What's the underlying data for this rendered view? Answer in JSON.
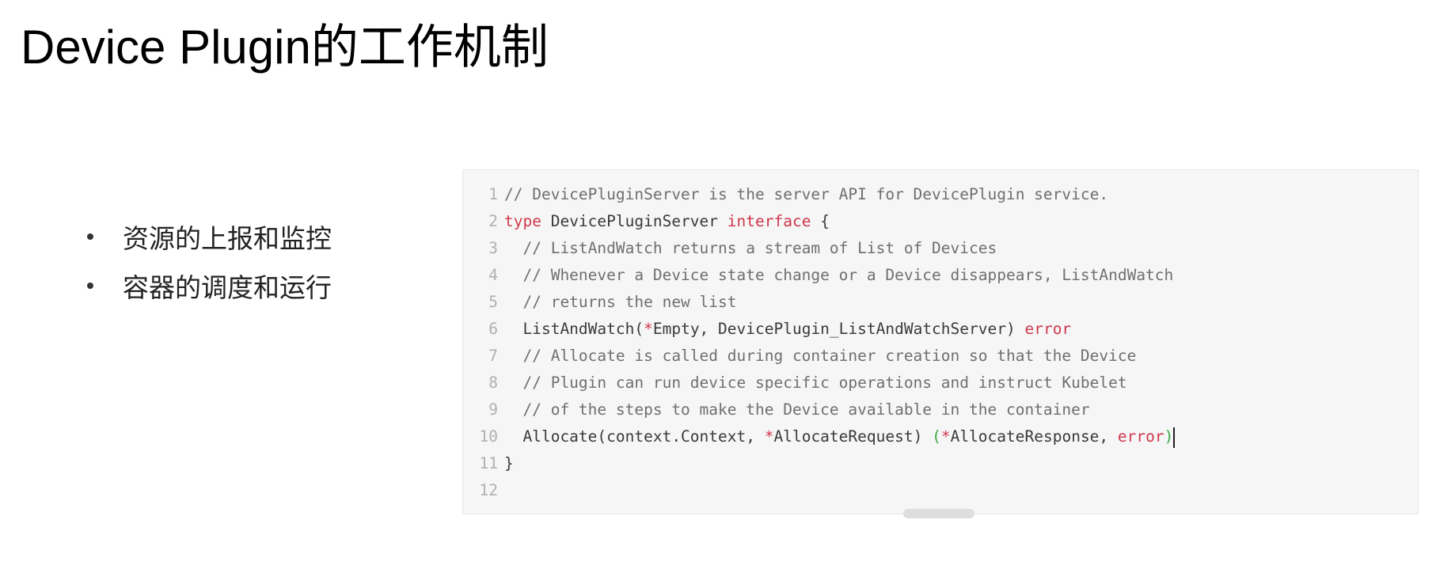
{
  "title": "Device Plugin的工作机制",
  "bullets": [
    "资源的上报和监控",
    "容器的调度和运行"
  ],
  "code": {
    "lines": [
      {
        "n": "1",
        "tokens": [
          {
            "t": "// DevicePluginServer is the server API for DevicePlugin service.",
            "c": "comment"
          }
        ]
      },
      {
        "n": "2",
        "tokens": [
          {
            "t": "type",
            "c": "kw"
          },
          {
            "t": " DevicePluginServer ",
            "c": "plain"
          },
          {
            "t": "interface",
            "c": "kw"
          },
          {
            "t": " {",
            "c": "plain"
          }
        ]
      },
      {
        "n": "3",
        "tokens": [
          {
            "t": "  // ListAndWatch returns a stream of List of Devices",
            "c": "comment"
          }
        ]
      },
      {
        "n": "4",
        "tokens": [
          {
            "t": "  // Whenever a Device state change or a Device disappears, ListAndWatch",
            "c": "comment"
          }
        ]
      },
      {
        "n": "5",
        "tokens": [
          {
            "t": "  // returns the new list",
            "c": "comment"
          }
        ]
      },
      {
        "n": "6",
        "tokens": [
          {
            "t": "  ListAndWatch(",
            "c": "plain"
          },
          {
            "t": "*",
            "c": "red"
          },
          {
            "t": "Empty, DevicePlugin_ListAndWatchServer) ",
            "c": "plain"
          },
          {
            "t": "error",
            "c": "red"
          }
        ]
      },
      {
        "n": "7",
        "tokens": [
          {
            "t": "  // Allocate is called during container creation so that the Device",
            "c": "comment"
          }
        ]
      },
      {
        "n": "8",
        "tokens": [
          {
            "t": "  // Plugin can run device specific operations and instruct Kubelet",
            "c": "comment"
          }
        ]
      },
      {
        "n": "9",
        "tokens": [
          {
            "t": "  // of the steps to make the Device available in the container",
            "c": "comment"
          }
        ]
      },
      {
        "n": "10",
        "tokens": [
          {
            "t": "  Allocate(context.Context, ",
            "c": "plain"
          },
          {
            "t": "*",
            "c": "red"
          },
          {
            "t": "AllocateRequest) ",
            "c": "plain"
          },
          {
            "t": "(",
            "c": "green"
          },
          {
            "t": "*",
            "c": "red"
          },
          {
            "t": "AllocateResponse, ",
            "c": "plain"
          },
          {
            "t": "error",
            "c": "red"
          },
          {
            "t": ")",
            "c": "green"
          }
        ],
        "caret": true
      },
      {
        "n": "11",
        "tokens": [
          {
            "t": "}",
            "c": "plain"
          }
        ]
      },
      {
        "n": "12",
        "tokens": []
      }
    ]
  },
  "colors": {
    "keyword": "#d0384d",
    "comment": "#6f6f6f",
    "bracket": "#3ba843",
    "panel_bg": "#f6f6f6"
  }
}
